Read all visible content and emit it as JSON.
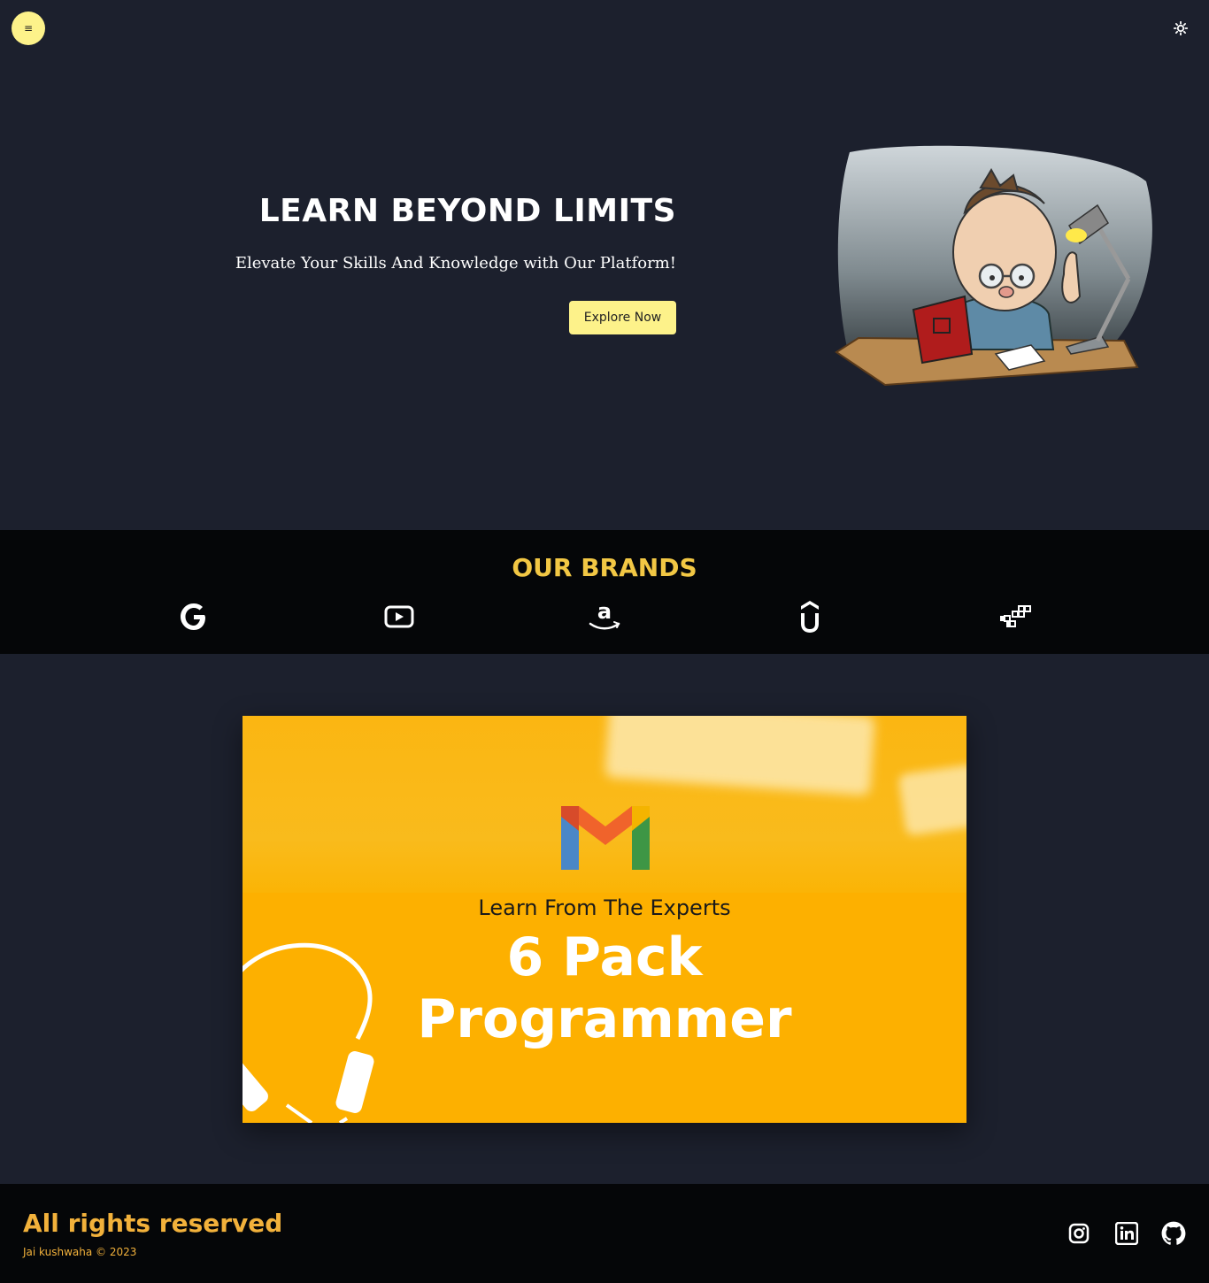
{
  "header": {
    "menu_icon": "menu-icon",
    "menu_glyph": "≡",
    "theme_icon": "sun-icon"
  },
  "hero": {
    "title": "LEARN BEYOND LIMITS",
    "subtitle": "Elevate Your Skills And Knowledge with Our Platform!",
    "cta_label": "Explore Now",
    "illustration": "reading-man-illustration"
  },
  "brands": {
    "title": "OUR BRANDS",
    "items": [
      {
        "name": "google-icon"
      },
      {
        "name": "youtube-icon"
      },
      {
        "name": "amazon-icon"
      },
      {
        "name": "udemy-icon"
      },
      {
        "name": "coursera-icon"
      }
    ]
  },
  "promo": {
    "kicker": "Learn From The Experts",
    "title_line1": "6 Pack",
    "title_line2": "Programmer",
    "logo_icon": "gmail-icon"
  },
  "footer": {
    "title": "All rights reserved",
    "copyright": "Jai kushwaha © 2023",
    "social": [
      "instagram-icon",
      "linkedin-icon",
      "github-icon"
    ]
  },
  "colors": {
    "page_bg": "#1c202d",
    "band_bg": "#050608",
    "accent_yellow": "#fdf28a",
    "brand_gold": "#f2c744",
    "promo_yellow": "#fdb000"
  }
}
